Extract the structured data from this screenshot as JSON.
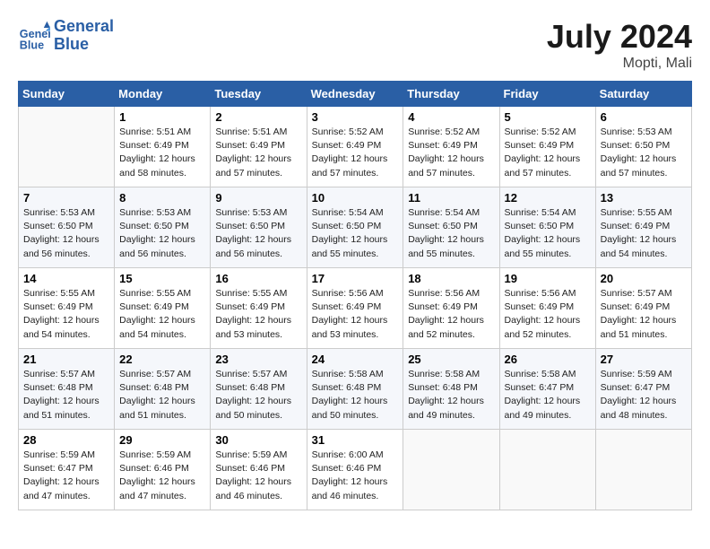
{
  "header": {
    "logo_line1": "General",
    "logo_line2": "Blue",
    "month_title": "July 2024",
    "location": "Mopti, Mali"
  },
  "columns": [
    "Sunday",
    "Monday",
    "Tuesday",
    "Wednesday",
    "Thursday",
    "Friday",
    "Saturday"
  ],
  "weeks": [
    [
      {
        "day": "",
        "info": ""
      },
      {
        "day": "1",
        "info": "Sunrise: 5:51 AM\nSunset: 6:49 PM\nDaylight: 12 hours\nand 58 minutes."
      },
      {
        "day": "2",
        "info": "Sunrise: 5:51 AM\nSunset: 6:49 PM\nDaylight: 12 hours\nand 57 minutes."
      },
      {
        "day": "3",
        "info": "Sunrise: 5:52 AM\nSunset: 6:49 PM\nDaylight: 12 hours\nand 57 minutes."
      },
      {
        "day": "4",
        "info": "Sunrise: 5:52 AM\nSunset: 6:49 PM\nDaylight: 12 hours\nand 57 minutes."
      },
      {
        "day": "5",
        "info": "Sunrise: 5:52 AM\nSunset: 6:49 PM\nDaylight: 12 hours\nand 57 minutes."
      },
      {
        "day": "6",
        "info": "Sunrise: 5:53 AM\nSunset: 6:50 PM\nDaylight: 12 hours\nand 57 minutes."
      }
    ],
    [
      {
        "day": "7",
        "info": "Sunrise: 5:53 AM\nSunset: 6:50 PM\nDaylight: 12 hours\nand 56 minutes."
      },
      {
        "day": "8",
        "info": "Sunrise: 5:53 AM\nSunset: 6:50 PM\nDaylight: 12 hours\nand 56 minutes."
      },
      {
        "day": "9",
        "info": "Sunrise: 5:53 AM\nSunset: 6:50 PM\nDaylight: 12 hours\nand 56 minutes."
      },
      {
        "day": "10",
        "info": "Sunrise: 5:54 AM\nSunset: 6:50 PM\nDaylight: 12 hours\nand 55 minutes."
      },
      {
        "day": "11",
        "info": "Sunrise: 5:54 AM\nSunset: 6:50 PM\nDaylight: 12 hours\nand 55 minutes."
      },
      {
        "day": "12",
        "info": "Sunrise: 5:54 AM\nSunset: 6:50 PM\nDaylight: 12 hours\nand 55 minutes."
      },
      {
        "day": "13",
        "info": "Sunrise: 5:55 AM\nSunset: 6:49 PM\nDaylight: 12 hours\nand 54 minutes."
      }
    ],
    [
      {
        "day": "14",
        "info": "Sunrise: 5:55 AM\nSunset: 6:49 PM\nDaylight: 12 hours\nand 54 minutes."
      },
      {
        "day": "15",
        "info": "Sunrise: 5:55 AM\nSunset: 6:49 PM\nDaylight: 12 hours\nand 54 minutes."
      },
      {
        "day": "16",
        "info": "Sunrise: 5:55 AM\nSunset: 6:49 PM\nDaylight: 12 hours\nand 53 minutes."
      },
      {
        "day": "17",
        "info": "Sunrise: 5:56 AM\nSunset: 6:49 PM\nDaylight: 12 hours\nand 53 minutes."
      },
      {
        "day": "18",
        "info": "Sunrise: 5:56 AM\nSunset: 6:49 PM\nDaylight: 12 hours\nand 52 minutes."
      },
      {
        "day": "19",
        "info": "Sunrise: 5:56 AM\nSunset: 6:49 PM\nDaylight: 12 hours\nand 52 minutes."
      },
      {
        "day": "20",
        "info": "Sunrise: 5:57 AM\nSunset: 6:49 PM\nDaylight: 12 hours\nand 51 minutes."
      }
    ],
    [
      {
        "day": "21",
        "info": "Sunrise: 5:57 AM\nSunset: 6:48 PM\nDaylight: 12 hours\nand 51 minutes."
      },
      {
        "day": "22",
        "info": "Sunrise: 5:57 AM\nSunset: 6:48 PM\nDaylight: 12 hours\nand 51 minutes."
      },
      {
        "day": "23",
        "info": "Sunrise: 5:57 AM\nSunset: 6:48 PM\nDaylight: 12 hours\nand 50 minutes."
      },
      {
        "day": "24",
        "info": "Sunrise: 5:58 AM\nSunset: 6:48 PM\nDaylight: 12 hours\nand 50 minutes."
      },
      {
        "day": "25",
        "info": "Sunrise: 5:58 AM\nSunset: 6:48 PM\nDaylight: 12 hours\nand 49 minutes."
      },
      {
        "day": "26",
        "info": "Sunrise: 5:58 AM\nSunset: 6:47 PM\nDaylight: 12 hours\nand 49 minutes."
      },
      {
        "day": "27",
        "info": "Sunrise: 5:59 AM\nSunset: 6:47 PM\nDaylight: 12 hours\nand 48 minutes."
      }
    ],
    [
      {
        "day": "28",
        "info": "Sunrise: 5:59 AM\nSunset: 6:47 PM\nDaylight: 12 hours\nand 47 minutes."
      },
      {
        "day": "29",
        "info": "Sunrise: 5:59 AM\nSunset: 6:46 PM\nDaylight: 12 hours\nand 47 minutes."
      },
      {
        "day": "30",
        "info": "Sunrise: 5:59 AM\nSunset: 6:46 PM\nDaylight: 12 hours\nand 46 minutes."
      },
      {
        "day": "31",
        "info": "Sunrise: 6:00 AM\nSunset: 6:46 PM\nDaylight: 12 hours\nand 46 minutes."
      },
      {
        "day": "",
        "info": ""
      },
      {
        "day": "",
        "info": ""
      },
      {
        "day": "",
        "info": ""
      }
    ]
  ]
}
